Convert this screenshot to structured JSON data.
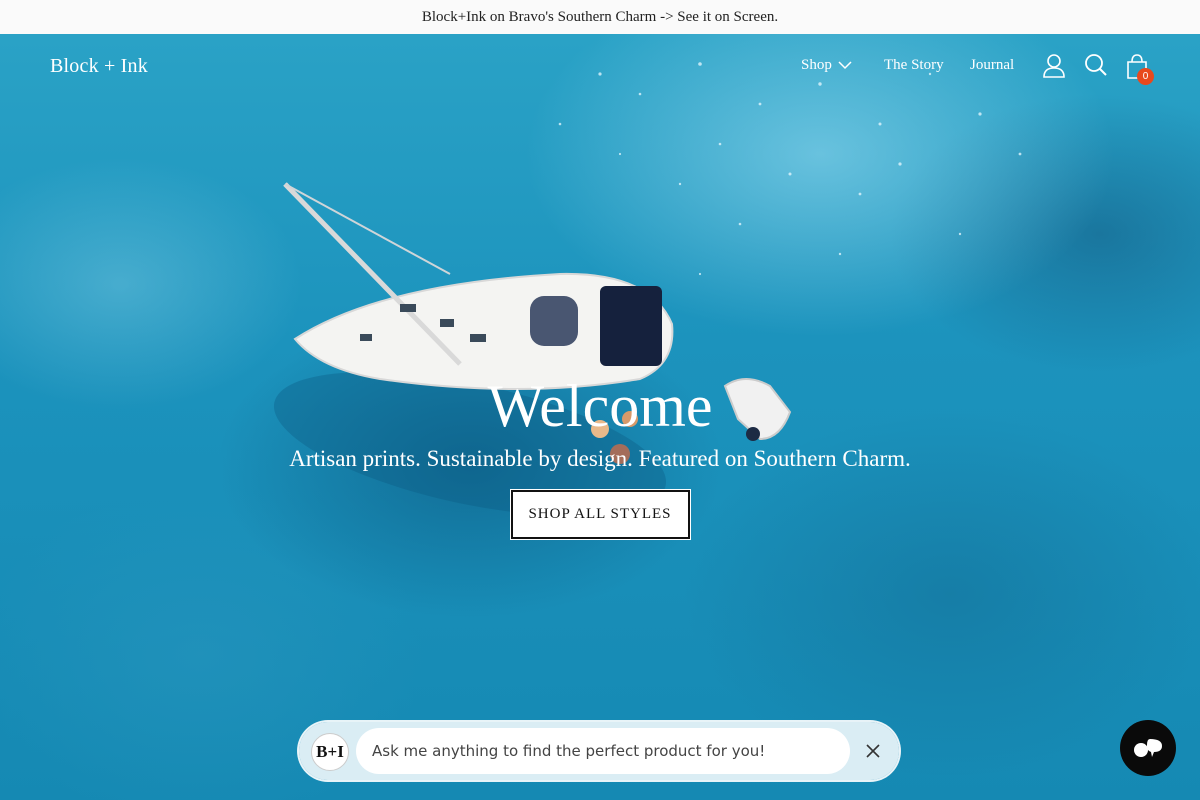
{
  "announcement": {
    "text": "Block+Ink on Bravo's Southern Charm -> See it on Screen."
  },
  "header": {
    "logo": "Block + Ink",
    "nav": [
      {
        "label": "Shop",
        "has_dropdown": true
      },
      {
        "label": "The Story"
      },
      {
        "label": "Journal"
      }
    ],
    "icons": [
      "account-icon",
      "search-icon",
      "cart-icon"
    ],
    "cart_count": "0"
  },
  "hero": {
    "title": "Welcome",
    "subtitle": "Artisan prints. Sustainable by design. Featured on Southern Charm.",
    "cta_label": "SHOP ALL STYLES"
  },
  "chat": {
    "avatar_text": "B+I",
    "placeholder": "Ask me anything to find the perfect product for you!"
  },
  "colors": {
    "sea": "#1a8fb3",
    "badge": "#e8491d",
    "fab": "#0a0a0a"
  }
}
